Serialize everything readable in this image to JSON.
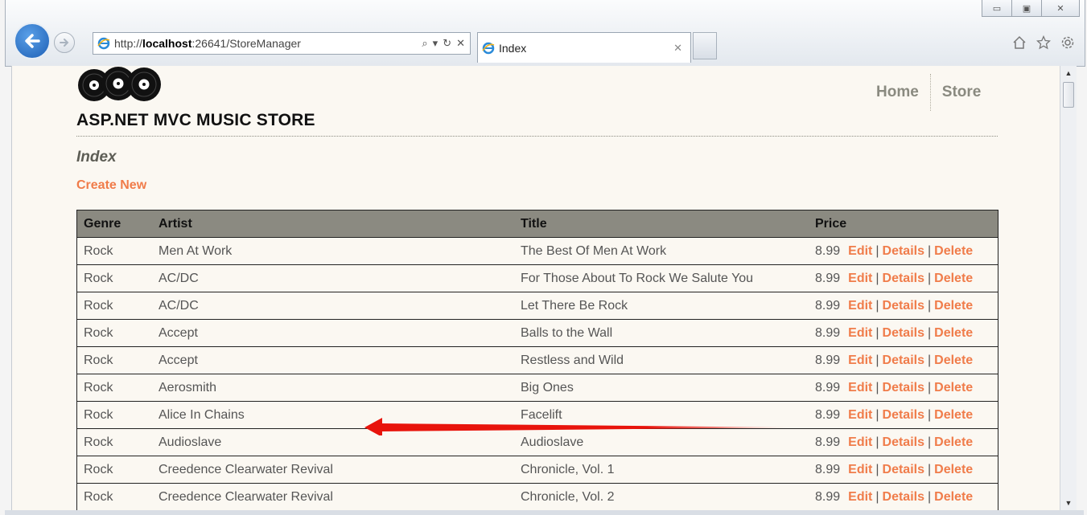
{
  "browser": {
    "address_prefix": "http://",
    "address_host": "localhost",
    "address_rest": ":26641/StoreManager",
    "tab_title": "Index",
    "window_buttons": [
      "minimize",
      "maximize",
      "close"
    ],
    "tool_icons": [
      "home-icon",
      "favorites-icon",
      "settings-icon"
    ]
  },
  "site": {
    "title": "ASP.NET MVC MUSIC STORE",
    "nav": [
      "Home",
      "Store"
    ]
  },
  "page": {
    "heading": "Index",
    "create_new": "Create New"
  },
  "table": {
    "headers": [
      "Genre",
      "Artist",
      "Title",
      "Price"
    ],
    "action_labels": {
      "edit": "Edit",
      "details": "Details",
      "delete": "Delete",
      "separator": "|"
    },
    "rows": [
      {
        "genre": "Rock",
        "artist": "Men At Work",
        "title": "The Best Of Men At Work",
        "price": "8.99"
      },
      {
        "genre": "Rock",
        "artist": "AC/DC",
        "title": "For Those About To Rock We Salute You",
        "price": "8.99"
      },
      {
        "genre": "Rock",
        "artist": "AC/DC",
        "title": "Let There Be Rock",
        "price": "8.99"
      },
      {
        "genre": "Rock",
        "artist": "Accept",
        "title": "Balls to the Wall",
        "price": "8.99"
      },
      {
        "genre": "Rock",
        "artist": "Accept",
        "title": "Restless and Wild",
        "price": "8.99"
      },
      {
        "genre": "Rock",
        "artist": "Aerosmith",
        "title": "Big Ones",
        "price": "8.99"
      },
      {
        "genre": "Rock",
        "artist": "Alice In Chains",
        "title": "Facelift",
        "price": "8.99"
      },
      {
        "genre": "Rock",
        "artist": "Audioslave",
        "title": "Audioslave",
        "price": "8.99"
      },
      {
        "genre": "Rock",
        "artist": "Creedence Clearwater Revival",
        "title": "Chronicle, Vol. 1",
        "price": "8.99"
      },
      {
        "genre": "Rock",
        "artist": "Creedence Clearwater Revival",
        "title": "Chronicle, Vol. 2",
        "price": "8.99"
      }
    ]
  },
  "colors": {
    "accent": "#f07c4a",
    "header_bg": "#8b8a81",
    "page_bg": "#fbf8f2",
    "annotation_arrow": "#e8140c"
  }
}
